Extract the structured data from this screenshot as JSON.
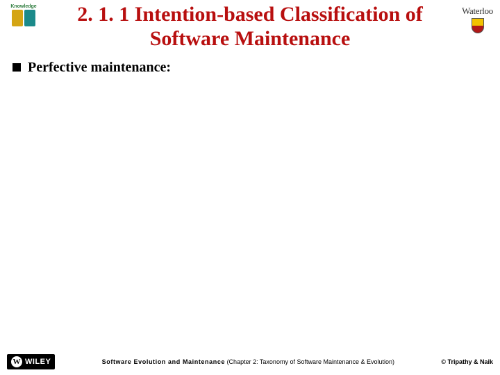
{
  "header": {
    "title_line1": "2. 1. 1 Intention-based Classification of",
    "title_line2": "Software Maintenance",
    "logo_left_label": "Knowledge",
    "logo_right_text": "Waterloo"
  },
  "content": {
    "bullet1": "Perfective maintenance:"
  },
  "footer": {
    "wiley_text": "WILEY",
    "book_title": "Software Evolution and Maintenance",
    "chapter_text": " (Chapter 2: Taxonomy of Software Maintenance & Evolution)",
    "copyright": "© Tripathy & Naik"
  }
}
